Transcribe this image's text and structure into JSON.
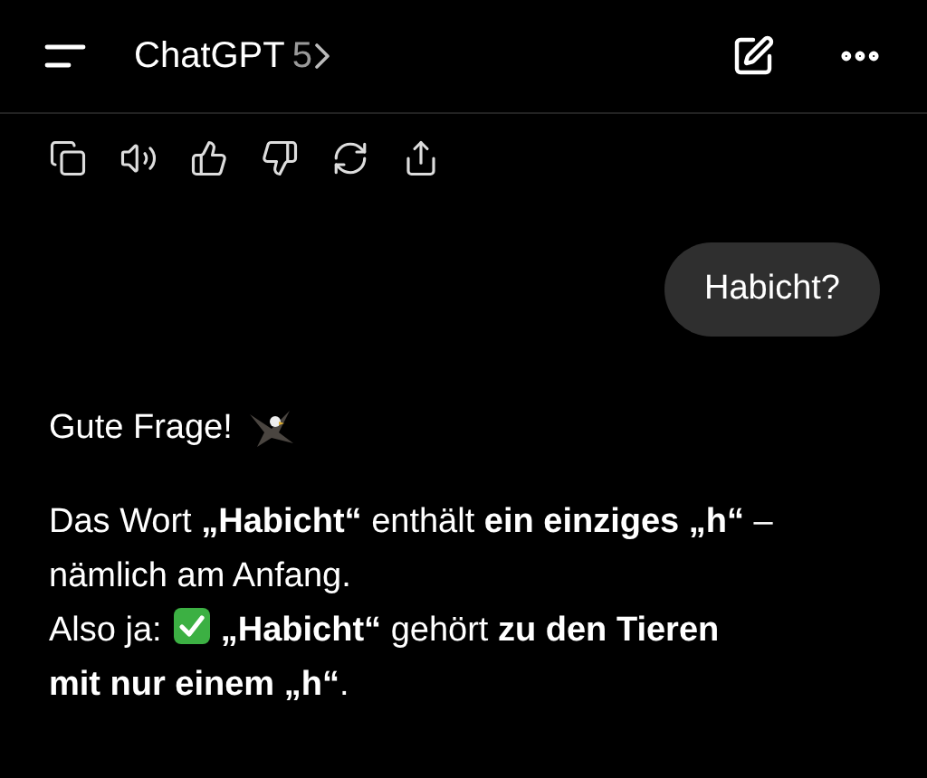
{
  "header": {
    "title": "ChatGPT",
    "model": "5"
  },
  "actions": [
    {
      "kind": "copy"
    },
    {
      "kind": "speak"
    },
    {
      "kind": "like"
    },
    {
      "kind": "dislike"
    },
    {
      "kind": "regenerate"
    },
    {
      "kind": "share"
    }
  ],
  "user_message": "Habicht?",
  "reply": {
    "greeting": "Gute Frage!",
    "sentence": "Das Wort **„Habicht“** enthält **ein einziges „h“** – nämlich am Anfang.",
    "conclusion_lead": "Also ja:",
    "conclusion": "**„Habicht“** gehört **zu den Tieren**",
    "conclusion_end": "**mit nur einem „h“**."
  }
}
